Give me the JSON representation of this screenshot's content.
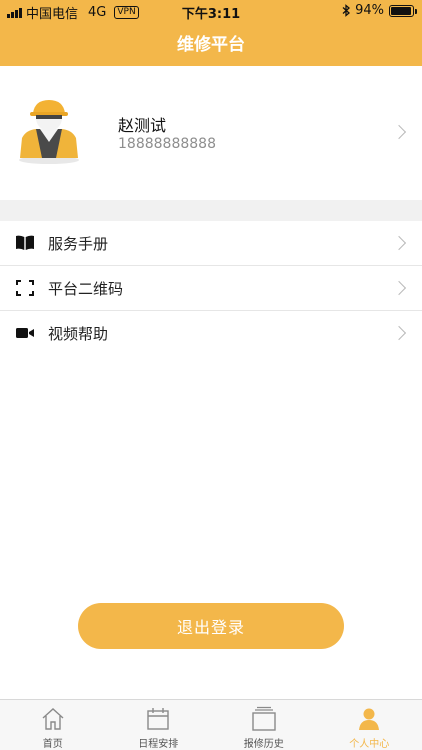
{
  "status_bar": {
    "carrier": "中国电信",
    "network": "4G",
    "vpn": "VPN",
    "time": "下午3:11",
    "battery_percent": "94%",
    "battery_level": 0.94
  },
  "header": {
    "title": "维修平台"
  },
  "profile": {
    "name": "赵测试",
    "phone": "18888888888"
  },
  "menu": {
    "items": [
      {
        "label": "服务手册",
        "icon": "book-icon"
      },
      {
        "label": "平台二维码",
        "icon": "qr-scan-icon"
      },
      {
        "label": "视频帮助",
        "icon": "video-camera-icon"
      }
    ]
  },
  "logout_label": "退出登录",
  "tabs": [
    {
      "label": "首页",
      "icon": "home-icon",
      "active": false
    },
    {
      "label": "日程安排",
      "icon": "calendar-icon",
      "active": false
    },
    {
      "label": "报修历史",
      "icon": "history-icon",
      "active": false
    },
    {
      "label": "个人中心",
      "icon": "user-icon",
      "active": true
    }
  ],
  "colors": {
    "accent": "#f3b74a",
    "separator": "#f1f1f1",
    "secondary_text": "#8e8e8e"
  }
}
